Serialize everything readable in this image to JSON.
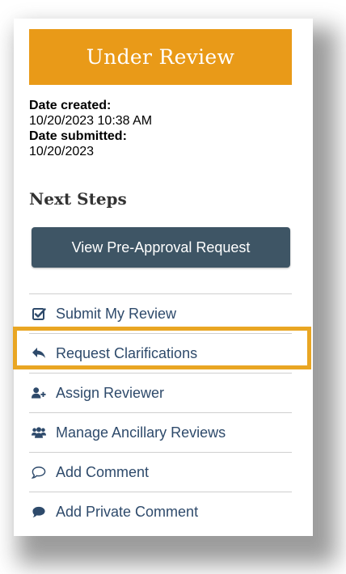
{
  "status": {
    "label": "Under Review",
    "color": "#e99a18"
  },
  "dates": {
    "created_label": "Date created:",
    "created_value": "10/20/2023 10:38 AM",
    "submitted_label": "Date submitted:",
    "submitted_value": "10/20/2023"
  },
  "next_steps": {
    "heading": "Next Steps",
    "primary_button": "View Pre-Approval Request"
  },
  "actions": [
    {
      "label": "Submit My Review",
      "icon": "checkbox-check-icon"
    },
    {
      "label": "Request Clarifications",
      "icon": "reply-arrow-icon",
      "highlighted": true
    },
    {
      "label": "Assign Reviewer",
      "icon": "user-add-icon"
    },
    {
      "label": "Manage Ancillary Reviews",
      "icon": "users-group-icon"
    },
    {
      "label": "Add Comment",
      "icon": "comment-outline-icon"
    },
    {
      "label": "Add Private Comment",
      "icon": "comment-solid-icon"
    }
  ],
  "colors": {
    "action_text": "#2e4a6b",
    "primary_button_bg": "#3e5565",
    "highlight_border": "#e9a623"
  }
}
